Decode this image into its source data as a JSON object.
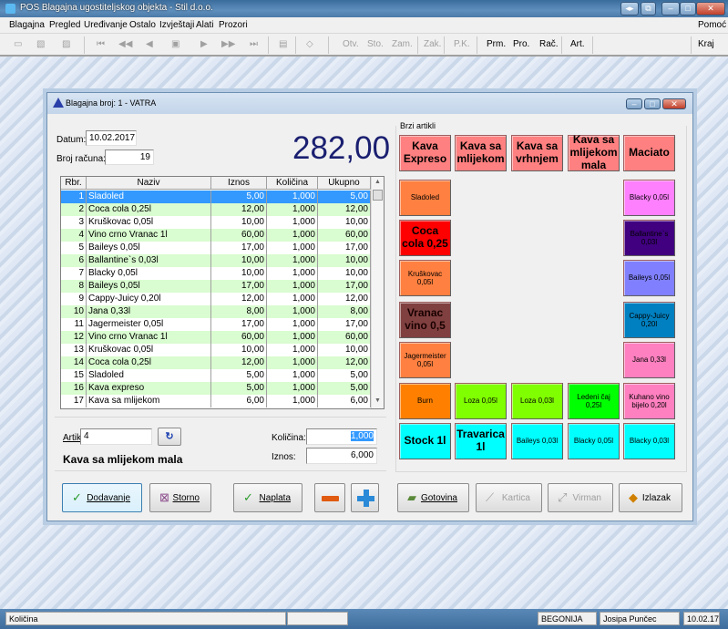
{
  "app": {
    "title": "POS Blagajna ugostiteljskog objekta - Stil d.o.o."
  },
  "menu": {
    "items": [
      "Blagajna",
      "Pregled",
      "Uređivanje",
      "Ostalo",
      "Izvještaji",
      "Alati",
      "Prozori"
    ],
    "help": "Pomoć"
  },
  "toolbar": {
    "text_buttons": [
      {
        "label": "Otv.",
        "enabled": false
      },
      {
        "label": "Sto.",
        "enabled": false
      },
      {
        "label": "Zam.",
        "enabled": false
      },
      {
        "label": "Zak.",
        "enabled": false
      },
      {
        "label": "P.K.",
        "enabled": false
      },
      {
        "label": "Prm.",
        "enabled": true
      },
      {
        "label": "Pro.",
        "enabled": true
      },
      {
        "label": "Rač.",
        "enabled": true
      },
      {
        "label": "Art.",
        "enabled": true
      }
    ],
    "exit": "Kraj"
  },
  "window": {
    "title": "Blagajna broj: 1 - VATRA"
  },
  "form": {
    "datum_label": "Datum:",
    "datum": "10.02.2017",
    "broj_label": "Broj računa:",
    "broj": "19",
    "total": "282,00"
  },
  "table": {
    "headers": [
      "Rbr.",
      "Naziv",
      "Iznos",
      "Količina",
      "Ukupno"
    ],
    "selected_row": 0,
    "rows": [
      [
        "1",
        "Sladoled",
        "5,00",
        "1,000",
        "5,00"
      ],
      [
        "2",
        "Coca cola 0,25l",
        "12,00",
        "1,000",
        "12,00"
      ],
      [
        "3",
        "Kruškovac 0,05l",
        "10,00",
        "1,000",
        "10,00"
      ],
      [
        "4",
        "Vino crno Vranac 1l",
        "60,00",
        "1,000",
        "60,00"
      ],
      [
        "5",
        "Baileys 0,05l",
        "17,00",
        "1,000",
        "17,00"
      ],
      [
        "6",
        "Ballantine`s 0,03l",
        "10,00",
        "1,000",
        "10,00"
      ],
      [
        "7",
        "Blacky 0,05l",
        "10,00",
        "1,000",
        "10,00"
      ],
      [
        "8",
        "Baileys 0,05l",
        "17,00",
        "1,000",
        "17,00"
      ],
      [
        "9",
        "Cappy-Juicy 0,20l",
        "12,00",
        "1,000",
        "12,00"
      ],
      [
        "10",
        "Jana 0,33l",
        "8,00",
        "1,000",
        "8,00"
      ],
      [
        "11",
        "Jagermeister 0,05l",
        "17,00",
        "1,000",
        "17,00"
      ],
      [
        "12",
        "Vino crno Vranac 1l",
        "60,00",
        "1,000",
        "60,00"
      ],
      [
        "13",
        "Kruškovac 0,05l",
        "10,00",
        "1,000",
        "10,00"
      ],
      [
        "14",
        "Coca cola 0,25l",
        "12,00",
        "1,000",
        "12,00"
      ],
      [
        "15",
        "Sladoled",
        "5,00",
        "1,000",
        "5,00"
      ],
      [
        "16",
        "Kava expreso",
        "5,00",
        "1,000",
        "5,00"
      ],
      [
        "17",
        "Kava sa mlijekom",
        "6,00",
        "1,000",
        "6,00"
      ]
    ]
  },
  "entry": {
    "artikl_label": "Artikl:",
    "artikl": "4",
    "article_name": "Kava sa mlijekom mala",
    "kolicina_label": "Količina:",
    "kolicina": "1,000",
    "iznos_label": "Iznos:",
    "iznos": "6,000"
  },
  "quick": {
    "title": "Brzi artikli",
    "buttons": [
      {
        "label": "Kava Expreso",
        "color": "#ff8080",
        "big": true
      },
      {
        "label": "Kava sa mlijekom",
        "color": "#ff8080",
        "big": true
      },
      {
        "label": "Kava sa vrhnjem",
        "color": "#ff8080",
        "big": true
      },
      {
        "label": "Kava sa mlijekom mala",
        "color": "#ff8080",
        "big": true
      },
      {
        "label": "Maciato",
        "color": "#ff8080",
        "big": true
      },
      {
        "label": "Sladoled",
        "color": "#ff8040"
      },
      {
        "label": "Blacky 0,05l",
        "color": "#ff80ff"
      },
      {
        "label": "Coca cola 0,25",
        "color": "#ff0000",
        "big": true
      },
      {
        "label": "Ballantine`s 0,03l",
        "color": "#400080"
      },
      {
        "label": "Kruškovac 0,05l",
        "color": "#ff8040"
      },
      {
        "label": "Baileys 0,05l",
        "color": "#8080ff"
      },
      {
        "label": "Vranac vino 0,5",
        "color": "#804040",
        "big": true
      },
      {
        "label": "Cappy-Juicy 0,20l",
        "color": "#0080c0"
      },
      {
        "label": "Jagermeister 0,05l",
        "color": "#ff8040"
      },
      {
        "label": "Jana 0,33l",
        "color": "#ff80c0"
      },
      {
        "label": "Burn",
        "color": "#ff8000"
      },
      {
        "label": "Loza 0,05l",
        "color": "#80ff00"
      },
      {
        "label": "Loza 0,03l",
        "color": "#80ff00"
      },
      {
        "label": "Ledeni čaj 0,25l",
        "color": "#00ff00"
      },
      {
        "label": "Kuhano vino bijelo 0,20l",
        "color": "#ff80c0"
      },
      {
        "label": "Stock 1l",
        "color": "#00ffff",
        "big": true
      },
      {
        "label": "Travarica 1l",
        "color": "#00ffff",
        "big": true
      },
      {
        "label": "Baileys 0,03l",
        "color": "#00ffff"
      },
      {
        "label": "Blacky 0,05l",
        "color": "#00ffff"
      },
      {
        "label": "Blacky 0,03l",
        "color": "#00ffff"
      }
    ]
  },
  "actions": {
    "dodavanje": "Dodavanje",
    "storno": "Storno",
    "naplata": "Naplata",
    "gotovina": "Gotovina",
    "kartica": "Kartica",
    "virman": "Virman",
    "izlazak": "Izlazak"
  },
  "status": {
    "field": "Količina",
    "location": "BEGONIJA",
    "user": "Josipa Punčec",
    "date": "10.02.17"
  }
}
